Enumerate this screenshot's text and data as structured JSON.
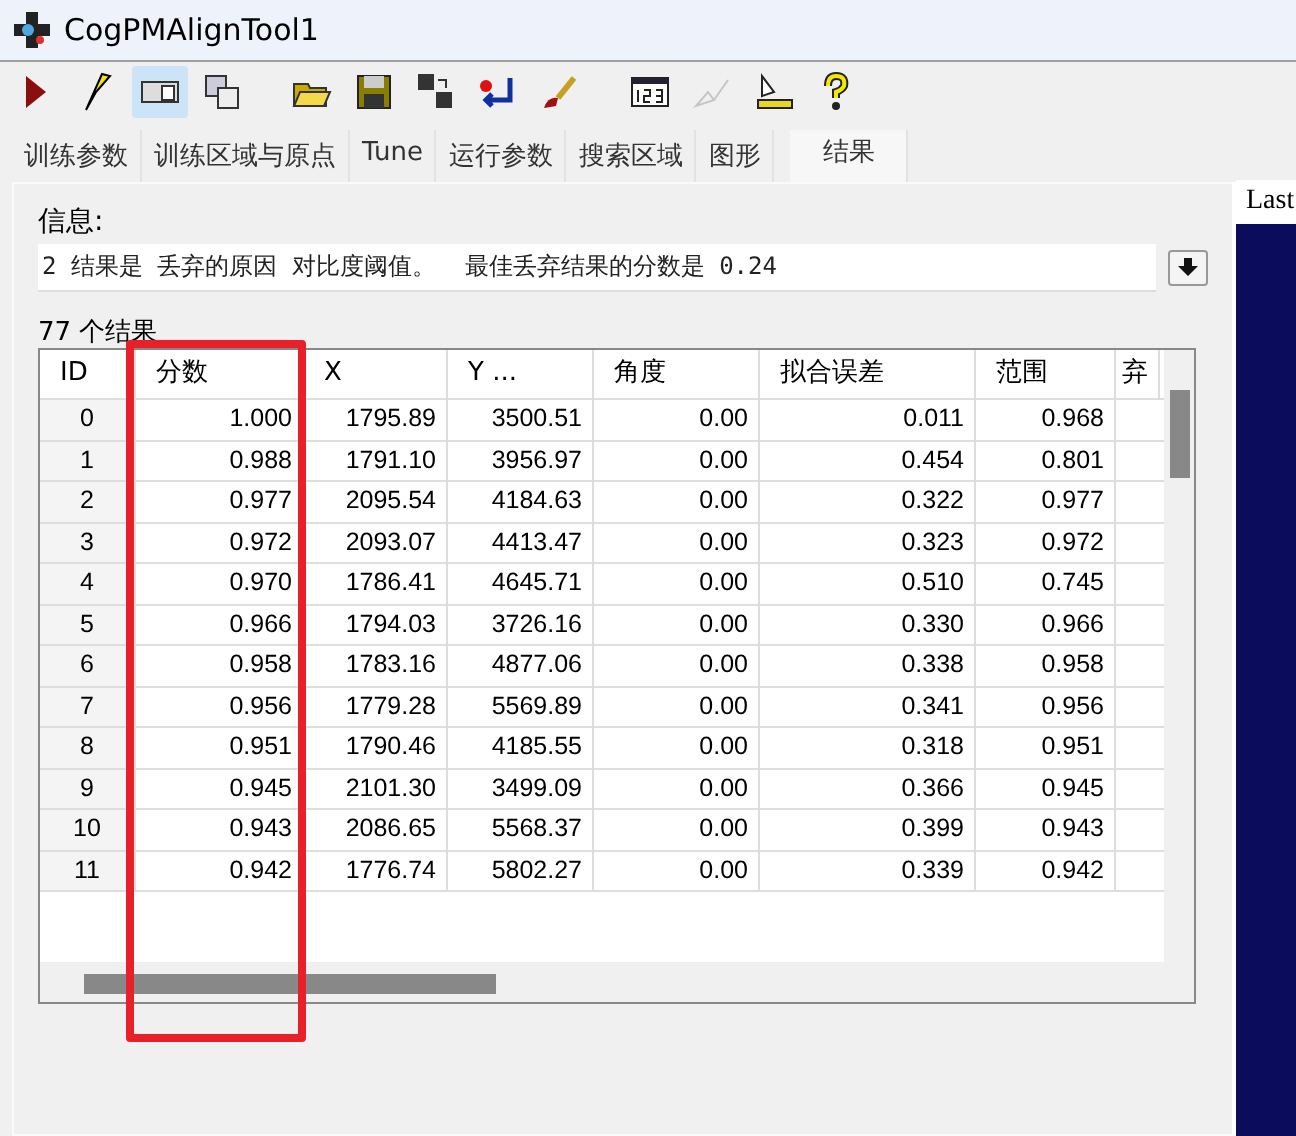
{
  "window": {
    "title": "CogPMAlignTool1"
  },
  "toolbar": [
    {
      "kind": "run",
      "selected": false,
      "disabled": false
    },
    {
      "kind": "lightning",
      "selected": false,
      "disabled": false
    },
    {
      "kind": "panel",
      "selected": true,
      "disabled": false
    },
    {
      "kind": "windows",
      "selected": false,
      "disabled": false
    },
    {
      "kind": "gap"
    },
    {
      "kind": "folder",
      "selected": false,
      "disabled": false
    },
    {
      "kind": "save",
      "selected": false,
      "disabled": false
    },
    {
      "kind": "save-multi",
      "selected": false,
      "disabled": false
    },
    {
      "kind": "reset",
      "selected": false,
      "disabled": false
    },
    {
      "kind": "brush",
      "selected": false,
      "disabled": false
    },
    {
      "kind": "gap"
    },
    {
      "kind": "counter",
      "selected": false,
      "disabled": false
    },
    {
      "kind": "edit",
      "selected": false,
      "disabled": true
    },
    {
      "kind": "ruler",
      "selected": false,
      "disabled": false
    },
    {
      "kind": "help",
      "selected": false,
      "disabled": false
    }
  ],
  "tabs": [
    {
      "label": "训练参数",
      "selected": false
    },
    {
      "label": "训练区域与原点",
      "selected": false
    },
    {
      "label": "Tune",
      "selected": false
    },
    {
      "label": "运行参数",
      "selected": false
    },
    {
      "label": "搜索区域",
      "selected": false
    },
    {
      "label": "图形",
      "selected": false
    },
    {
      "label": "结果",
      "selected": true
    }
  ],
  "info": {
    "label": "信息:",
    "message": "2 结果是 丢弃的原因 对比度阈值。  最佳丢弃结果的分数是 0.24"
  },
  "results": {
    "count_label": "77 个结果",
    "columns": [
      "ID",
      "分数",
      "X",
      "Y ...",
      "角度",
      "拟合误差",
      "范围",
      "弃"
    ],
    "highlight_frame": true,
    "rows": [
      [
        "0",
        "1.000",
        "1795.89",
        "3500.51",
        "0.00",
        "0.011",
        "0.968"
      ],
      [
        "1",
        "0.988",
        "1791.10",
        "3956.97",
        "0.00",
        "0.454",
        "0.801"
      ],
      [
        "2",
        "0.977",
        "2095.54",
        "4184.63",
        "0.00",
        "0.322",
        "0.977"
      ],
      [
        "3",
        "0.972",
        "2093.07",
        "4413.47",
        "0.00",
        "0.323",
        "0.972"
      ],
      [
        "4",
        "0.970",
        "1786.41",
        "4645.71",
        "0.00",
        "0.510",
        "0.745"
      ],
      [
        "5",
        "0.966",
        "1794.03",
        "3726.16",
        "0.00",
        "0.330",
        "0.966"
      ],
      [
        "6",
        "0.958",
        "1783.16",
        "4877.06",
        "0.00",
        "0.338",
        "0.958"
      ],
      [
        "7",
        "0.956",
        "1779.28",
        "5569.89",
        "0.00",
        "0.341",
        "0.956"
      ],
      [
        "8",
        "0.951",
        "1790.46",
        "4185.55",
        "0.00",
        "0.318",
        "0.951"
      ],
      [
        "9",
        "0.945",
        "2101.30",
        "3499.09",
        "0.00",
        "0.366",
        "0.945"
      ],
      [
        "10",
        "0.943",
        "2086.65",
        "5568.37",
        "0.00",
        "0.399",
        "0.943"
      ],
      [
        "11",
        "0.942",
        "1776.74",
        "5802.27",
        "0.00",
        "0.339",
        "0.942"
      ]
    ]
  },
  "side_panel": {
    "header": "Last"
  }
}
